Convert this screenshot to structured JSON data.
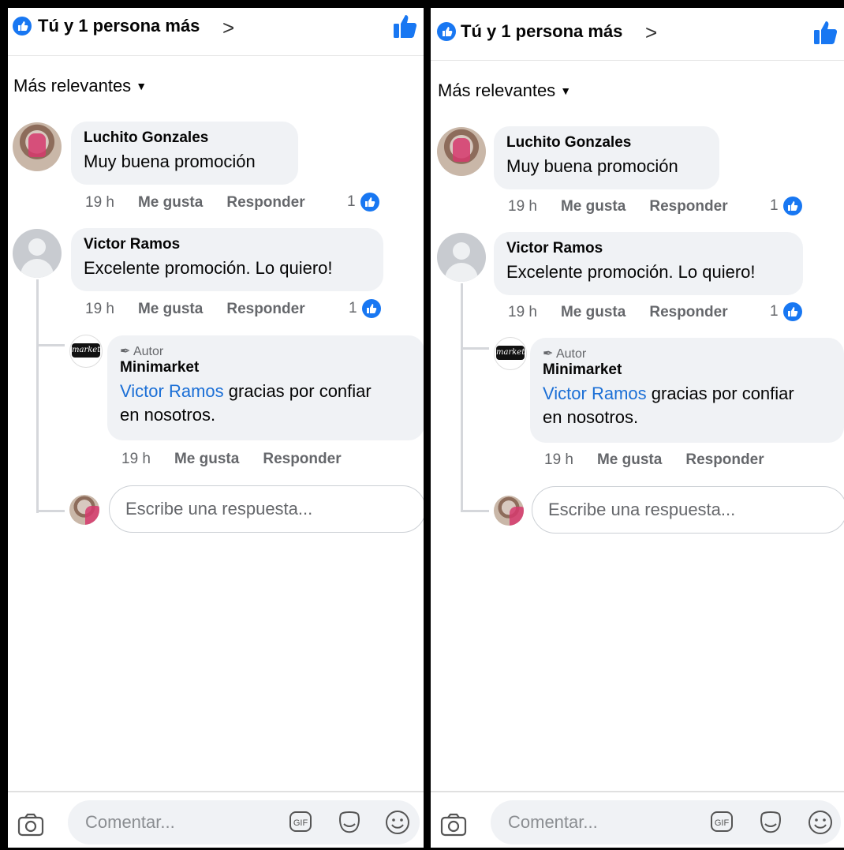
{
  "header": {
    "reactions_text": "Tú y 1 persona más",
    "chevron": ">"
  },
  "sort": {
    "label": "Más relevantes"
  },
  "comments": [
    {
      "author": "Luchito Gonzales",
      "text": "Muy buena promoción",
      "time": "19 h",
      "like": "Me gusta",
      "reply": "Responder",
      "likes": "1"
    },
    {
      "author": "Victor Ramos",
      "text": "Excelente promoción. Lo quiero!",
      "time": "19 h",
      "like": "Me gusta",
      "reply": "Responder",
      "likes": "1"
    }
  ],
  "reply": {
    "badge": "Autor",
    "author": "Minimarket",
    "mention": "Victor Ramos",
    "text_line1": " gracias por confiar",
    "text_line2": "en nosotros.",
    "time": "19 h",
    "like": "Me gusta",
    "reply": "Responder"
  },
  "reply_input": {
    "placeholder": "Escribe una respuesta..."
  },
  "composer": {
    "placeholder": "Comentar..."
  },
  "icons": [
    "like-icon",
    "thumbs-up-icon",
    "chevron-down-icon",
    "camera-icon",
    "gif-icon",
    "sticker-icon",
    "emoji-icon",
    "pencil-icon"
  ],
  "colors": {
    "brand": "#1877f2",
    "link": "#1b6fd6",
    "bubble": "#f0f2f5"
  }
}
